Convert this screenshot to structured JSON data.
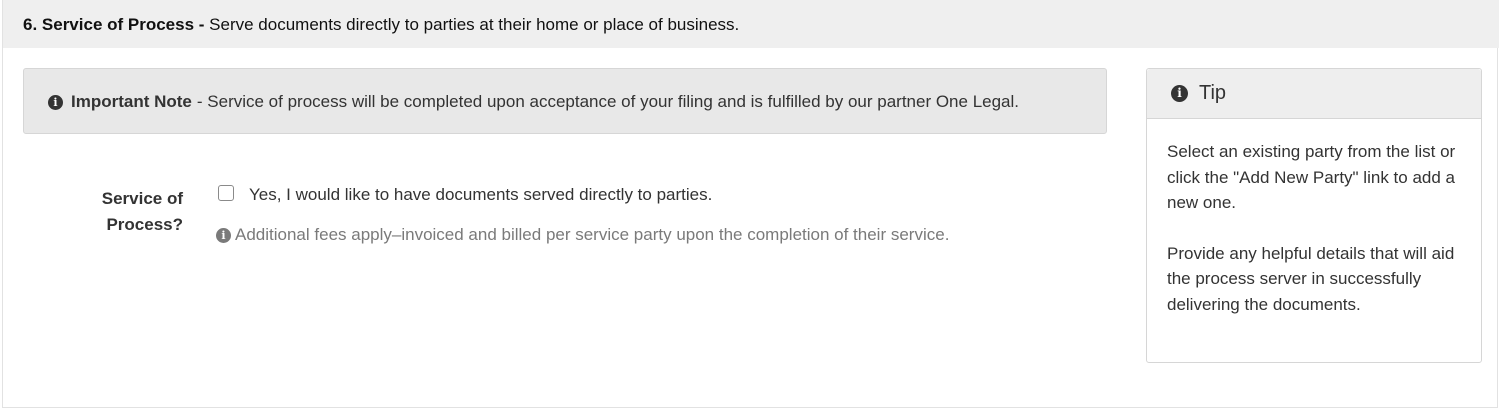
{
  "section": {
    "number_title": "6. Service of Process -",
    "description": "Serve documents directly to parties at their home or place of business."
  },
  "note": {
    "icon": "info-icon",
    "title": "Important Note",
    "text": "- Service of process will be completed upon acceptance of your filing and is fulfilled by our partner One Legal."
  },
  "form": {
    "label": "Service of Process?",
    "checkbox_label": "Yes, I would like to have documents served directly to parties.",
    "checkbox_checked": false,
    "help_text": "Additional fees apply–invoiced and billed per service party upon the completion of their service."
  },
  "tip": {
    "title": "Tip",
    "paragraph1": "Select an existing party from the list or click the \"Add New Party\" link to add a new one.",
    "paragraph2": "Provide any helpful details that will aid the process server in successfully delivering the documents."
  }
}
